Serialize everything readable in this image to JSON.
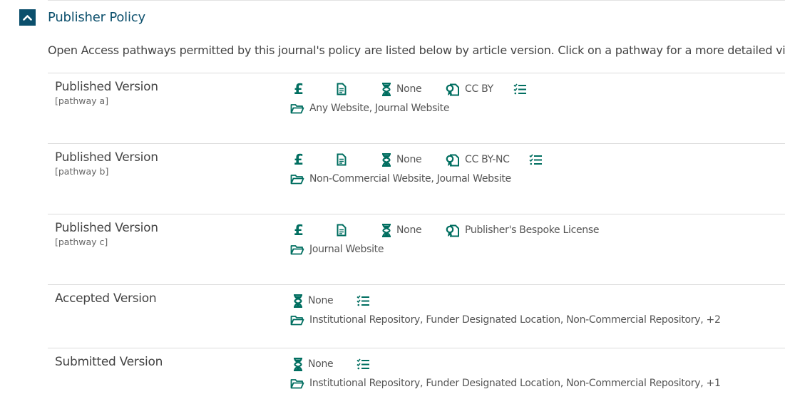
{
  "header": {
    "title": "Publisher Policy"
  },
  "intro": "Open Access pathways permitted by this journal's policy are listed below by article version. Click on a pathway for a more detailed view.",
  "colors": {
    "accent": "#0b4f6c",
    "icon": "#006e60",
    "rule": "#dcdcdc"
  },
  "pathways": [
    {
      "version": "Published Version",
      "pathway": "[pathway a]",
      "fee_symbol": "£",
      "embargo": "None",
      "license": "CC BY",
      "locations": "Any Website, Journal Website"
    },
    {
      "version": "Published Version",
      "pathway": "[pathway b]",
      "fee_symbol": "£",
      "embargo": "None",
      "license": "CC BY-NC",
      "locations": "Non-Commercial Website, Journal Website"
    },
    {
      "version": "Published Version",
      "pathway": "[pathway c]",
      "fee_symbol": "£",
      "embargo": "None",
      "license": "Publisher's Bespoke License",
      "locations": "Journal Website"
    },
    {
      "version": "Accepted Version",
      "embargo": "None",
      "locations": "Institutional Repository, Funder Designated Location, Non-Commercial Repository, +2"
    },
    {
      "version": "Submitted Version",
      "embargo": "None",
      "locations": "Institutional Repository, Funder Designated Location, Non-Commercial Repository, +1"
    }
  ],
  "icons": {
    "toggle": "chevron-up-icon",
    "fee": "pound-icon",
    "document": "document-icon",
    "embargo": "hourglass-icon",
    "license": "license-icon",
    "conditions": "checklist-icon",
    "location": "folder-icon"
  }
}
